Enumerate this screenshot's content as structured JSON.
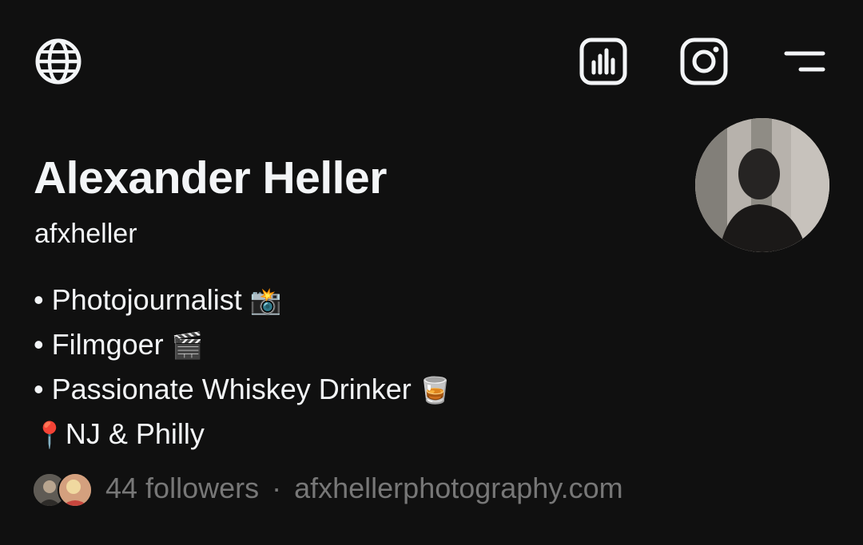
{
  "profile": {
    "name": "Alexander Heller",
    "handle": "afxheller",
    "bio": [
      {
        "text": "• Photojournalist",
        "emoji": "📸"
      },
      {
        "text": "• Filmgoer",
        "emoji": "🎬"
      },
      {
        "text": "• Passionate Whiskey Drinker",
        "emoji": "🥃"
      },
      {
        "text": "NJ & Philly",
        "emoji": "📍"
      }
    ],
    "followers": "44 followers",
    "separator": "·",
    "website": "afxhellerphotography.com"
  },
  "icons": {
    "globe": "globe-icon",
    "insights": "insights-icon",
    "instagram": "instagram-icon",
    "menu": "menu-icon"
  },
  "colors": {
    "background": "#101010",
    "text": "#f3f5f7",
    "muted": "#777777"
  }
}
